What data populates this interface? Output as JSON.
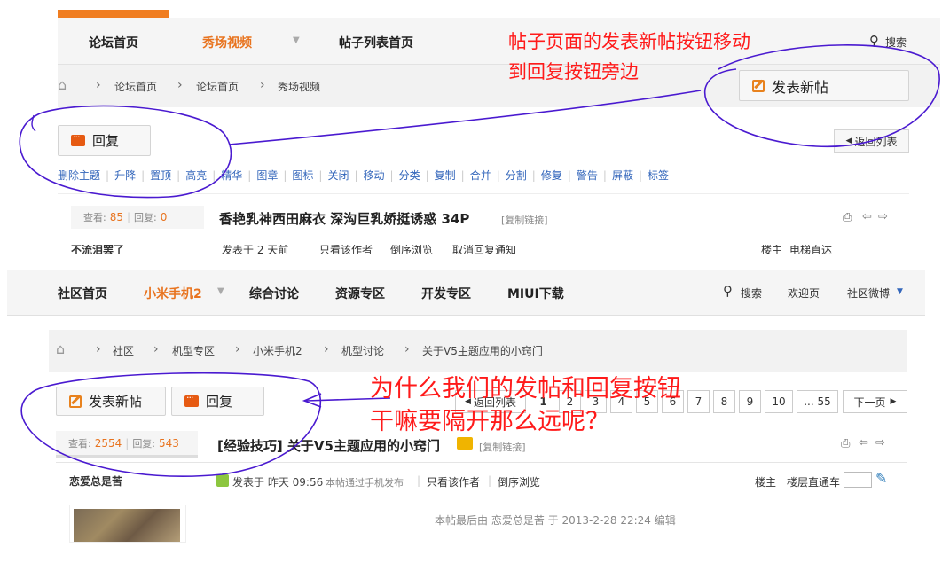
{
  "top": {
    "nav": [
      {
        "label": "论坛首页",
        "active": false
      },
      {
        "label": "秀场视频",
        "active": true
      },
      {
        "label": "帖子列表首页",
        "active": false
      }
    ],
    "search_label": "搜索",
    "breadcrumb": [
      "论坛首页",
      "论坛首页",
      "秀场视频"
    ],
    "new_post_label": "发表新帖",
    "reply_label": "回复",
    "back_list_label": "返回列表",
    "mod_tools": [
      "删除主题",
      "升降",
      "置顶",
      "高亮",
      "精华",
      "图章",
      "图标",
      "关闭",
      "移动",
      "分类",
      "复制",
      "合并",
      "分割",
      "修复",
      "警告",
      "屏蔽",
      "标签"
    ],
    "views_label": "查看:",
    "views": "85",
    "replies_label": "回复:",
    "replies": "0",
    "thread_title": "香艳乳神西田麻衣 深沟巨乳娇挺诱惑 34P",
    "copy_link": "[复制链接]",
    "author_partial": "不流泪罢了",
    "posted_partial": "发表于 2 天前",
    "only_author_partial": "只看该作者",
    "reverse_partial": "倒序浏览",
    "cancel_partial": "取消回复通知",
    "floor_partial": "楼主",
    "jump_partial": "电梯直达"
  },
  "bottom": {
    "nav": [
      {
        "label": "社区首页",
        "active": false
      },
      {
        "label": "小米手机2",
        "active": true
      },
      {
        "label": "综合讨论",
        "active": false
      },
      {
        "label": "资源专区",
        "active": false
      },
      {
        "label": "开发专区",
        "active": false
      },
      {
        "label": "MIUI下载",
        "active": false
      }
    ],
    "search_label": "搜索",
    "welcome_label": "欢迎页",
    "weibo_label": "社区微博",
    "breadcrumb": [
      "社区",
      "机型专区",
      "小米手机2",
      "机型讨论",
      "关于V5主题应用的小窍门"
    ],
    "new_post_label": "发表新帖",
    "reply_label": "回复",
    "back_list_label": "返回列表",
    "pages": [
      "1",
      "2",
      "3",
      "4",
      "5",
      "6",
      "7",
      "8",
      "9",
      "10",
      "... 55"
    ],
    "next_label": "下一页",
    "views_label": "查看:",
    "views": "2554",
    "replies_label": "回复:",
    "replies": "543",
    "thread_title": "[经验技巧] 关于V5主题应用的小窍门",
    "copy_link": "[复制链接]",
    "author": "恋爱总是苦",
    "posted": "发表于 昨天 09:56",
    "mobile_note": "本帖通过手机发布",
    "only_author": "只看该作者",
    "reverse": "倒序浏览",
    "floor": "楼主",
    "jump": "楼层直通车",
    "edit_note": "本帖最后由 恋爱总是苦 于 2013-2-28 22:24 编辑"
  },
  "annotations": {
    "top_line1": "帖子页面的发表新帖按钮移动",
    "top_line2": "到回复按钮旁边",
    "bottom_line1": "为什么我们的发帖和回复按钮",
    "bottom_line2": "干嘛要隔开那么远呢？",
    "color": "#ff1a1a",
    "circle_color": "#4a1ad0"
  },
  "colors": {
    "accent": "#e8731e",
    "link": "#3366bb",
    "nav_bg": "#f5f5f5"
  }
}
